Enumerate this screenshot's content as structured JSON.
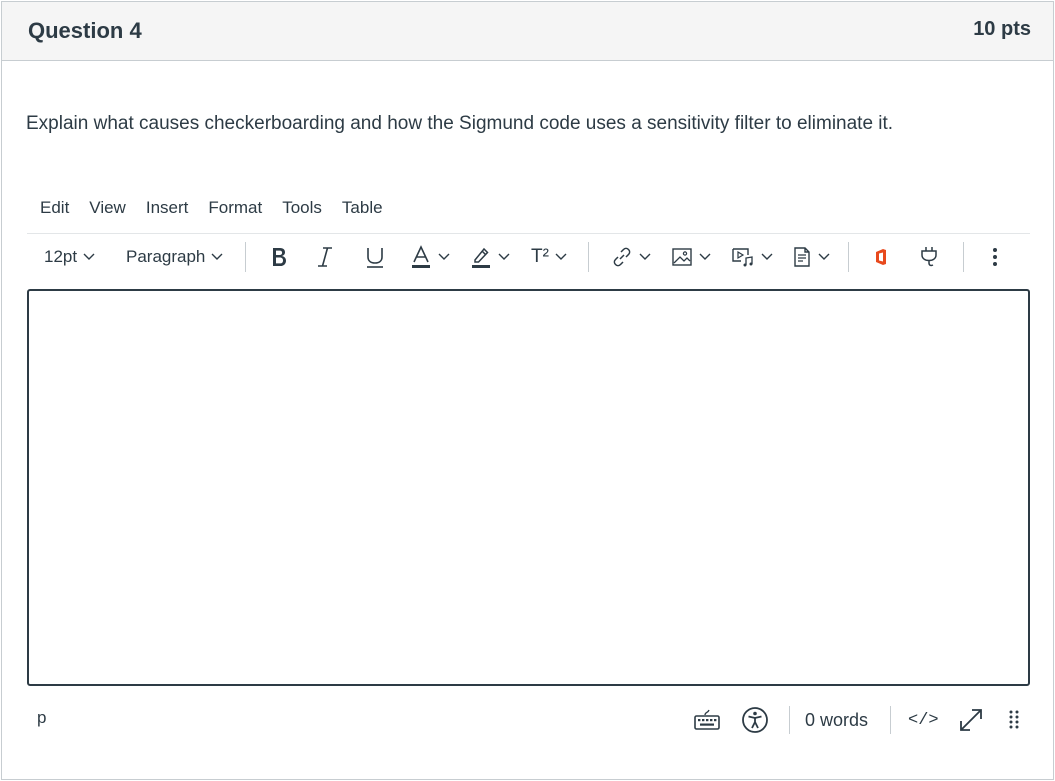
{
  "question": {
    "title": "Question 4",
    "points": "10 pts",
    "text": "Explain what causes checkerboarding and how the Sigmund code uses a sensitivity filter to eliminate it."
  },
  "menubar": {
    "items": [
      "Edit",
      "View",
      "Insert",
      "Format",
      "Tools",
      "Table"
    ]
  },
  "toolbar": {
    "font_size": "12pt",
    "block_format": "Paragraph",
    "superscript_label": "T²",
    "icons": [
      "bold-icon",
      "italic-icon",
      "underline-icon",
      "text-color-icon",
      "highlight-icon",
      "superscript-icon",
      "link-icon",
      "image-icon",
      "media-icon",
      "document-icon",
      "office-icon",
      "plugin-icon",
      "more-icon"
    ],
    "office_color": "#e8491d"
  },
  "editor": {
    "content": ""
  },
  "statusbar": {
    "path": "p",
    "word_count": "0 words",
    "html_toggle": "</>"
  },
  "colors": {
    "text": "#2d3b45",
    "header_bg": "#f5f5f5",
    "border": "#c7cdd1",
    "accent": "#2d3b45"
  }
}
